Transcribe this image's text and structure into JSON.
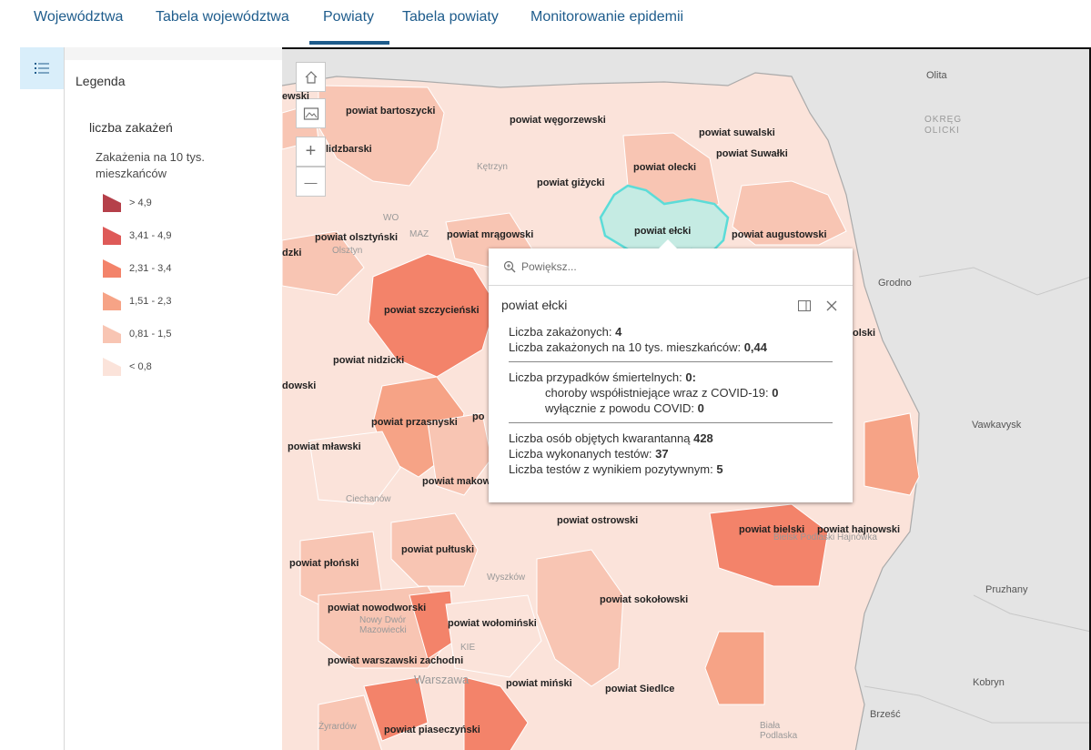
{
  "tabs": [
    {
      "label": "Województwa",
      "active": false
    },
    {
      "label": "Tabela województwa",
      "active": false
    },
    {
      "label": "Powiaty",
      "active": true
    },
    {
      "label": "Tabela powiaty",
      "active": false
    },
    {
      "label": "Monitorowanie epidemii",
      "active": false
    }
  ],
  "legend": {
    "title": "Legenda",
    "layer_title": "liczba zakażeń",
    "field_title": "Zakażenia na 10 tys. mieszkańców",
    "classes": [
      {
        "label": "> 4,9",
        "color": "#b5404a"
      },
      {
        "label": "3,41 - 4,9",
        "color": "#de5a58"
      },
      {
        "label": "2,31 - 3,4",
        "color": "#f3836a"
      },
      {
        "label": "1,51 - 2,3",
        "color": "#f6a386"
      },
      {
        "label": "0,81 - 1,5",
        "color": "#f8c5b3"
      },
      {
        "label": "< 0,8",
        "color": "#fbe3da"
      }
    ]
  },
  "map_controls": {
    "home_icon": "home-icon",
    "basemap_icon": "basemap-gallery-icon",
    "zoom_in": "+",
    "zoom_out": "—"
  },
  "map_labels": {
    "bartoszycki": "powiat bartoszycki",
    "wegorzewski": "powiat węgorzewski",
    "suwalski": "powiat suwalski",
    "suwalki": "powiat Suwałki",
    "olecki": "powiat olecki",
    "lidzbarski": "lidzbarski",
    "gizycki": "powiat giżycki",
    "elcki": "powiat ełcki",
    "augustowski": "powiat augustowski",
    "olsztynski": "powiat olsztyński",
    "mragowski": "powiat mrągowski",
    "szczycienski": "powiat szczycieński",
    "nidzicki": "powiat nidzicki",
    "dowski": "dowski",
    "przasnyski": "powiat przasnyski",
    "po": "po",
    "mlawski": "powiat mławski",
    "makow": "powiat makow",
    "ostrowski": "powiat ostrowski",
    "bielski": "powiat bielski",
    "hajnowski": "powiat hajnowski",
    "pultuski": "powiat pułtuski",
    "plonski": "powiat płoński",
    "sokolowski": "powiat sokołowski",
    "nowodworski": "powiat nowodworski",
    "wolominski": "powiat wołomiński",
    "warszawski_zachodni": "powiat warszawski zachodni",
    "minski": "powiat miński",
    "siedlce": "powiat Siedlce",
    "piaseczynski": "powiat piaseczyński",
    "olski": "olski",
    "edge_ewski": "ewski",
    "edge_dzki": "dzki",
    "grodno": "Grodno",
    "vawkavysk": "Vawkavysk",
    "pruzhany": "Pruzhany",
    "kobryn": "Kobryn",
    "brzesc": "Brześć",
    "olita": "Olita",
    "okreg_olicki": "OKRĘG OLICKI",
    "ketrzyn": "Kętrzyn",
    "ciechanow": "Ciechanów",
    "wyszkow": "Wyszków",
    "warszawa": "Warszawa",
    "nowy_dwor": "Nowy Dwór Mazowiecki",
    "zyrardow": "Żyrardów",
    "biala_podlaska": "Biała Podlaska",
    "olsztyn": "Olsztyn",
    "bielsk_podlaski": "Bielsk Podlaski",
    "hajnowka": "Hajnówka",
    "maz": "MAZ",
    "wo": "WO",
    "kie": "KIE"
  },
  "popup": {
    "search_placeholder": "Powiększ...",
    "title": "powiat ełcki",
    "lines": [
      {
        "label": "Liczba zakażonych:",
        "value": "4"
      },
      {
        "label": "Liczba zakażonych na 10 tys. mieszkańców:",
        "value": "0,44"
      },
      {
        "label": "Liczba przypadków śmiertelnych:",
        "value": "0:"
      },
      {
        "label": "choroby współistniejące wraz z COVID-19:",
        "value": "0"
      },
      {
        "label": "wyłącznie z powodu COVID:",
        "value": "0"
      },
      {
        "label": "Liczba osób objętych kwarantanną",
        "value": "428"
      },
      {
        "label": "Liczba wykonanych testów:",
        "value": "37"
      },
      {
        "label": "Liczba testów z wynikiem pozytywnym:",
        "value": "5"
      }
    ]
  }
}
